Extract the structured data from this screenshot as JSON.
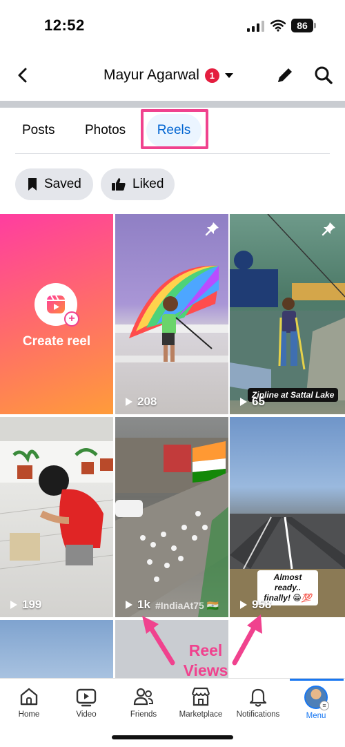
{
  "status_bar": {
    "time": "12:52",
    "battery": "86"
  },
  "header": {
    "title": "Mayur Agarwal",
    "badge_count": "1"
  },
  "tabs": [
    {
      "label": "Posts"
    },
    {
      "label": "Photos"
    },
    {
      "label": "Reels",
      "selected": true
    }
  ],
  "filters": {
    "saved_label": "Saved",
    "liked_label": "Liked"
  },
  "grid": {
    "create_label": "Create reel",
    "reels": [
      {
        "views": "208",
        "pinned": true
      },
      {
        "views": "65",
        "pinned": true,
        "caption": "Zipline at Sattal Lake"
      },
      {
        "views": "199"
      },
      {
        "views": "1k",
        "caption": "#IndiaAt75 🇮🇳"
      },
      {
        "views": "958",
        "caption": "Almost ready.. finally! 😁💯"
      }
    ]
  },
  "annotation": {
    "line1": "Reel",
    "line2": "Views",
    "color": "#f0428e"
  },
  "nav": [
    {
      "label": "Home",
      "icon": "home-icon"
    },
    {
      "label": "Video",
      "icon": "video-icon"
    },
    {
      "label": "Friends",
      "icon": "friends-icon"
    },
    {
      "label": "Marketplace",
      "icon": "marketplace-icon"
    },
    {
      "label": "Notifications",
      "icon": "bell-icon"
    },
    {
      "label": "Menu",
      "icon": "profile-avatar",
      "active": true
    }
  ],
  "colors": {
    "accent": "#1877f2",
    "highlight": "#f0428e",
    "tab_active_bg": "#ebf5ff"
  }
}
